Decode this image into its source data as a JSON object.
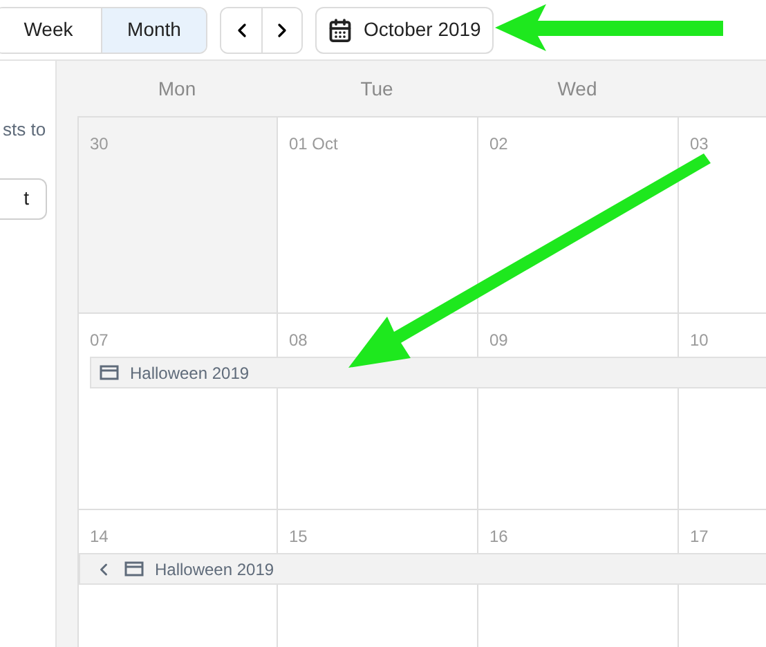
{
  "toolbar": {
    "views": [
      {
        "label": "Week",
        "selected": false
      },
      {
        "label": "Month",
        "selected": true
      }
    ],
    "date_button": "October 2019"
  },
  "sidebar": {
    "text": "sts to",
    "button": "t"
  },
  "weekdays": [
    "Mon",
    "Tue",
    "Wed"
  ],
  "weeks": [
    {
      "days": [
        {
          "label": "30",
          "outside": true
        },
        {
          "label": "01 Oct",
          "outside": false
        },
        {
          "label": "02",
          "outside": false
        },
        {
          "label": "03",
          "outside": false
        }
      ]
    },
    {
      "days": [
        {
          "label": "07",
          "outside": false
        },
        {
          "label": "08",
          "outside": false
        },
        {
          "label": "09",
          "outside": false
        },
        {
          "label": "10",
          "outside": false
        }
      ],
      "event": {
        "title": "Halloween 2019",
        "continues_before": false
      }
    },
    {
      "days": [
        {
          "label": "14",
          "outside": false
        },
        {
          "label": "15",
          "outside": false
        },
        {
          "label": "16",
          "outside": false
        },
        {
          "label": "17",
          "outside": false
        }
      ],
      "event": {
        "title": "Halloween 2019",
        "continues_before": true
      }
    }
  ]
}
